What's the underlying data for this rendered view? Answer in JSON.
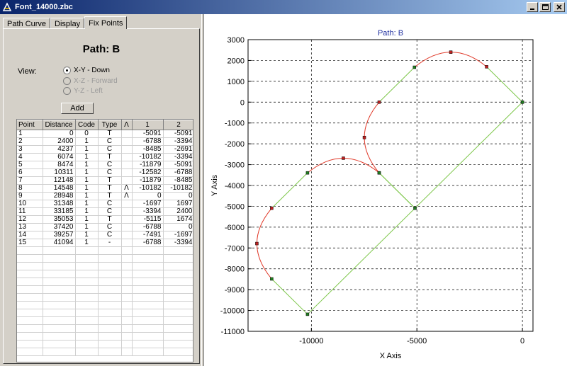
{
  "window": {
    "title": "Font_14000.zbc"
  },
  "tabs": [
    {
      "label": "Path Curve"
    },
    {
      "label": "Display"
    },
    {
      "label": "Fix Points"
    }
  ],
  "path_title": "Path: B",
  "view_label": "View:",
  "view_options": [
    {
      "label": "X-Y  -  Down",
      "selected": true,
      "enabled": true
    },
    {
      "label": "X-Z  -  Forward",
      "selected": false,
      "enabled": false
    },
    {
      "label": "Y-Z  -  Left",
      "selected": false,
      "enabled": false
    }
  ],
  "add_button": "Add",
  "table": {
    "headers": [
      "Point",
      "Distance",
      "Code",
      "Type",
      "Λ",
      "1",
      "2"
    ],
    "rows": [
      [
        "1",
        "0",
        "0",
        "T",
        "",
        "-5091",
        "-5091"
      ],
      [
        "2",
        "2400",
        "1",
        "C",
        "",
        "-6788",
        "-3394"
      ],
      [
        "3",
        "4237",
        "1",
        "C",
        "",
        "-8485",
        "-2691"
      ],
      [
        "4",
        "6074",
        "1",
        "T",
        "",
        "-10182",
        "-3394"
      ],
      [
        "5",
        "8474",
        "1",
        "C",
        "",
        "-11879",
        "-5091"
      ],
      [
        "6",
        "10311",
        "1",
        "C",
        "",
        "-12582",
        "-6788"
      ],
      [
        "7",
        "12148",
        "1",
        "T",
        "",
        "-11879",
        "-8485"
      ],
      [
        "8",
        "14548",
        "1",
        "T",
        "Λ",
        "-10182",
        "-10182"
      ],
      [
        "9",
        "28948",
        "1",
        "T",
        "Λ",
        "0",
        "0"
      ],
      [
        "10",
        "31348",
        "1",
        "C",
        "",
        "-1697",
        "1697"
      ],
      [
        "11",
        "33185",
        "1",
        "C",
        "",
        "-3394",
        "2400"
      ],
      [
        "12",
        "35053",
        "1",
        "T",
        "",
        "-5115",
        "1674"
      ],
      [
        "13",
        "37420",
        "1",
        "C",
        "",
        "-6788",
        "0"
      ],
      [
        "14",
        "39257",
        "1",
        "C",
        "",
        "-7491",
        "-1697"
      ],
      [
        "15",
        "41094",
        "1",
        "-",
        "",
        "-6788",
        "-3394"
      ]
    ]
  },
  "chart_data": {
    "type": "line",
    "title": "Path: B",
    "xlabel": "X Axis",
    "ylabel": "Y Axis",
    "xlim": [
      -13000,
      500
    ],
    "ylim": [
      -11000,
      3000
    ],
    "xticks": [
      -10000,
      -5000,
      0
    ],
    "yticks": [
      3000,
      2000,
      1000,
      0,
      -1000,
      -2000,
      -3000,
      -4000,
      -5000,
      -6000,
      -7000,
      -8000,
      -9000,
      -10000,
      -11000
    ],
    "grid": true,
    "colors": {
      "tangent": "#7cc648",
      "curve": "#e03a2a",
      "title": "#2030a0"
    },
    "points": [
      {
        "x": -5091,
        "y": -5091,
        "type": "T"
      },
      {
        "x": -6788,
        "y": -3394,
        "type": "C"
      },
      {
        "x": -8485,
        "y": -2691,
        "type": "C"
      },
      {
        "x": -10182,
        "y": -3394,
        "type": "T"
      },
      {
        "x": -11879,
        "y": -5091,
        "type": "C"
      },
      {
        "x": -12582,
        "y": -6788,
        "type": "C"
      },
      {
        "x": -11879,
        "y": -8485,
        "type": "T"
      },
      {
        "x": -10182,
        "y": -10182,
        "type": "T"
      },
      {
        "x": 0,
        "y": 0,
        "type": "T"
      },
      {
        "x": -1697,
        "y": 1697,
        "type": "C"
      },
      {
        "x": -3394,
        "y": 2400,
        "type": "C"
      },
      {
        "x": -5115,
        "y": 1674,
        "type": "T"
      },
      {
        "x": -6788,
        "y": 0,
        "type": "C"
      },
      {
        "x": -7491,
        "y": -1697,
        "type": "C"
      },
      {
        "x": -6788,
        "y": -3394,
        "type": "-"
      }
    ],
    "curve_segments": [
      [
        1,
        3
      ],
      [
        4,
        6
      ],
      [
        9,
        11
      ],
      [
        12,
        14
      ]
    ],
    "line_segments": [
      [
        0,
        1
      ],
      [
        3,
        4
      ],
      [
        6,
        7
      ],
      [
        7,
        8
      ],
      [
        8,
        9
      ],
      [
        11,
        12
      ],
      [
        14,
        0
      ]
    ]
  }
}
